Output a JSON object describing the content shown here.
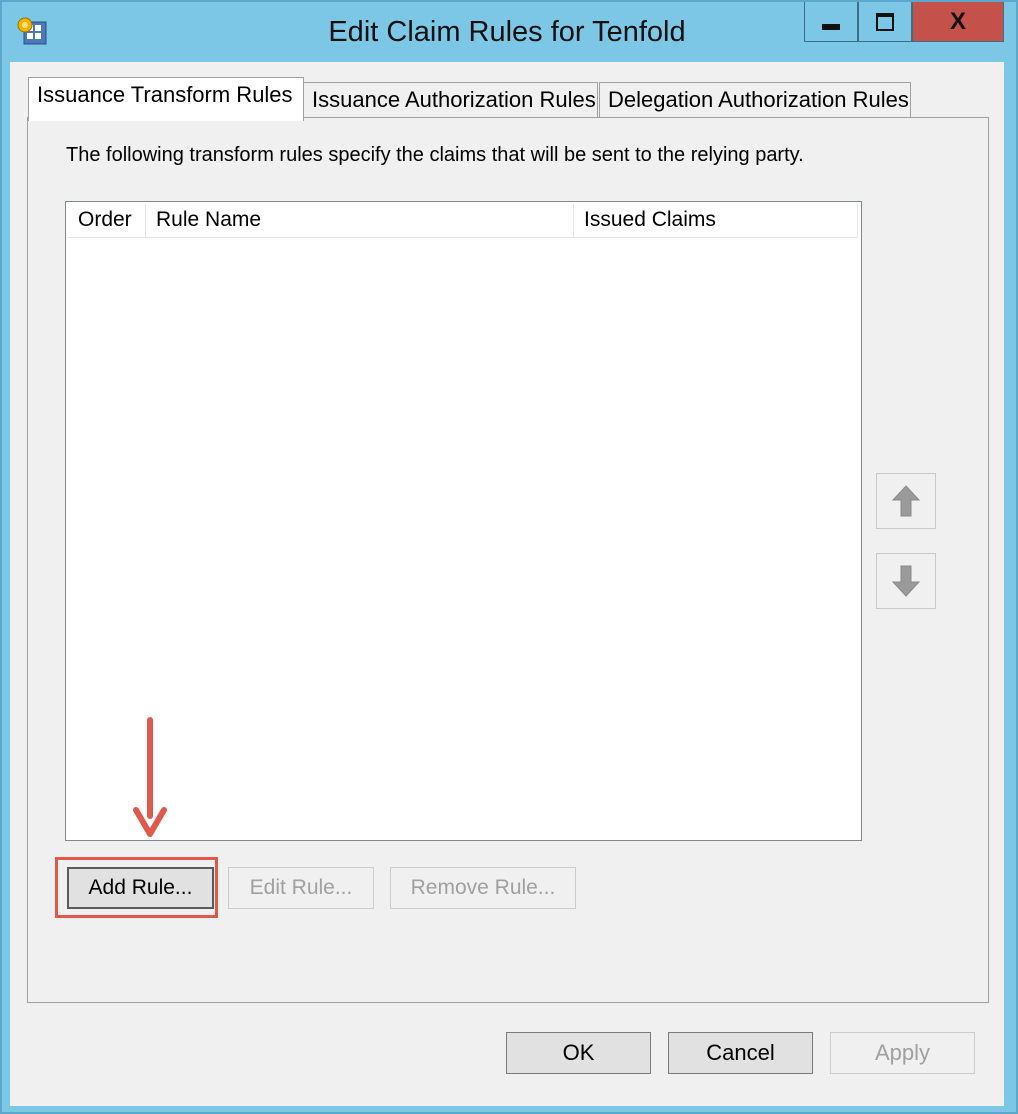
{
  "window": {
    "title": "Edit Claim Rules for Tenfold",
    "close_glyph": "X"
  },
  "tabs": [
    {
      "label": "Issuance Transform Rules",
      "active": true
    },
    {
      "label": "Issuance Authorization Rules",
      "active": false
    },
    {
      "label": "Delegation Authorization Rules",
      "active": false
    }
  ],
  "panel": {
    "description": "The following transform rules specify the claims that will be sent to the relying party.",
    "columns": [
      "Order",
      "Rule Name",
      "Issued Claims"
    ],
    "rows": []
  },
  "rule_buttons": {
    "add": "Add Rule...",
    "edit": "Edit Rule...",
    "remove": "Remove Rule..."
  },
  "dialog_buttons": {
    "ok": "OK",
    "cancel": "Cancel",
    "apply": "Apply"
  },
  "icons": {
    "app": "claim-rules-app-icon",
    "move_up": "arrow-up-icon",
    "move_down": "arrow-down-icon"
  },
  "colors": {
    "titlebar": "#7cc6e6",
    "close_button": "#c4514a",
    "annotation": "#e05a4c"
  }
}
